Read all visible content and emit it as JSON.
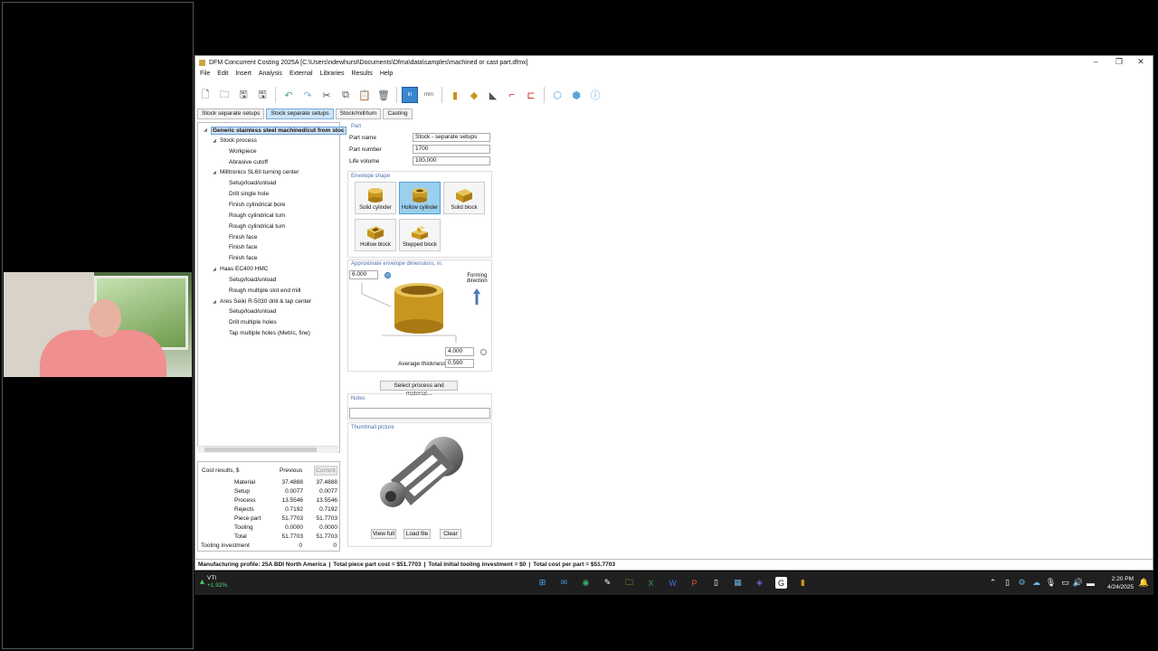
{
  "window": {
    "title": "DFM Concurrent Costing 2025A [C:\\Users\\ndewhurst\\Documents\\Dfma\\data\\samples\\machined or cast part.dfmx]"
  },
  "menu": [
    "File",
    "Edit",
    "Insert",
    "Analysis",
    "External",
    "Libraries",
    "Results",
    "Help"
  ],
  "toolbar": {
    "units_in": "in",
    "units_mm": "mm"
  },
  "tabs": [
    {
      "label": "Stock separate setups"
    },
    {
      "label": "Stock separate setups"
    },
    {
      "label": "Stock/mill/turn"
    },
    {
      "label": "Casting"
    }
  ],
  "tree": [
    {
      "label": "Generic stainless steel machined/cut from stoc",
      "level": 0
    },
    {
      "label": "Stock process",
      "level": 1
    },
    {
      "label": "Workpiece",
      "level": 2
    },
    {
      "label": "Abrasive cutoff",
      "level": 2
    },
    {
      "label": "Milltronics SL6II turning center",
      "level": 1
    },
    {
      "label": "Setup/load/unload",
      "level": 2
    },
    {
      "label": "Drill single hole",
      "level": 2
    },
    {
      "label": "Finish cylindrical bore",
      "level": 2
    },
    {
      "label": "Rough cylindrical turn",
      "level": 2
    },
    {
      "label": "Rough cylindrical turn",
      "level": 2
    },
    {
      "label": "Finish face",
      "level": 2
    },
    {
      "label": "Finish face",
      "level": 2
    },
    {
      "label": "Finish face",
      "level": 2
    },
    {
      "label": "Haas EC400 HMC",
      "level": 1
    },
    {
      "label": "Setup/load/unload",
      "level": 2
    },
    {
      "label": "Rough multiple slot end mill",
      "level": 2
    },
    {
      "label": "Ares Seiki R-5030 drill & tap center",
      "level": 1
    },
    {
      "label": "Setup/load/unload",
      "level": 2
    },
    {
      "label": "Drill multiple holes",
      "level": 2
    },
    {
      "label": "Tap multiple holes (Metric, fine)",
      "level": 2
    }
  ],
  "cost": {
    "header": "Cost results, $",
    "previous": "Previous",
    "current": "Current",
    "rows": [
      {
        "label": "Material",
        "prev": "37.4888",
        "curr": "37.4888"
      },
      {
        "label": "Setup",
        "prev": "0.0077",
        "curr": "0.0077"
      },
      {
        "label": "Process",
        "prev": "13.5546",
        "curr": "13.5546"
      },
      {
        "label": "Rejects",
        "prev": "0.7192",
        "curr": "0.7192"
      },
      {
        "label": "Piece part",
        "prev": "51.7703",
        "curr": "51.7703"
      },
      {
        "label": "Tooling",
        "prev": "0.0000",
        "curr": "0.0000"
      },
      {
        "label": "Total",
        "prev": "51.7703",
        "curr": "51.7703"
      }
    ],
    "tooling_investment": {
      "label": "Tooling investment",
      "prev": "0",
      "curr": "0"
    }
  },
  "part": {
    "section": "Part",
    "name_label": "Part name",
    "name_value": "Stock - separate setups",
    "number_label": "Part number",
    "number_value": "1700",
    "volume_label": "Life volume",
    "volume_value": "100,000"
  },
  "envelope": {
    "section": "Envelope shape",
    "shapes": [
      {
        "label": "Solid cylinder"
      },
      {
        "label": "Hollow cylinder"
      },
      {
        "label": "Solid block"
      },
      {
        "label": "Hollow block"
      },
      {
        "label": "Stepped block"
      }
    ],
    "selected": "Hollow cylinder"
  },
  "dimensions": {
    "section": "Approximate envelope dimensions, in.",
    "length": "6.000",
    "diameter": "4.000",
    "thickness_label": "Average thickness",
    "thickness": "0.590",
    "forming_label_1": "Forming",
    "forming_label_2": "direction",
    "select_button": "Select process and material..."
  },
  "notes": {
    "section": "Notes",
    "value": ""
  },
  "thumbnail": {
    "section": "Thumbnail picture",
    "view_full": "View full",
    "load_file": "Load file",
    "clear": "Clear"
  },
  "status": {
    "profile": "Manufacturing profile: 25A BDI North America",
    "piece": "Total piece part cost = $51.7703",
    "tooling": "Total initial tooling investment = $0",
    "total": "Total cost per part = $51.7703"
  },
  "taskbar": {
    "ticker_name": "VTI",
    "ticker_change": "+1.92%",
    "time": "2:20 PM",
    "date": "4/24/2025"
  },
  "colors": {
    "accent": "#3a86d1",
    "selection": "#9ad0ee",
    "section_text": "#4b6fb0",
    "gold": "#c8951e"
  }
}
